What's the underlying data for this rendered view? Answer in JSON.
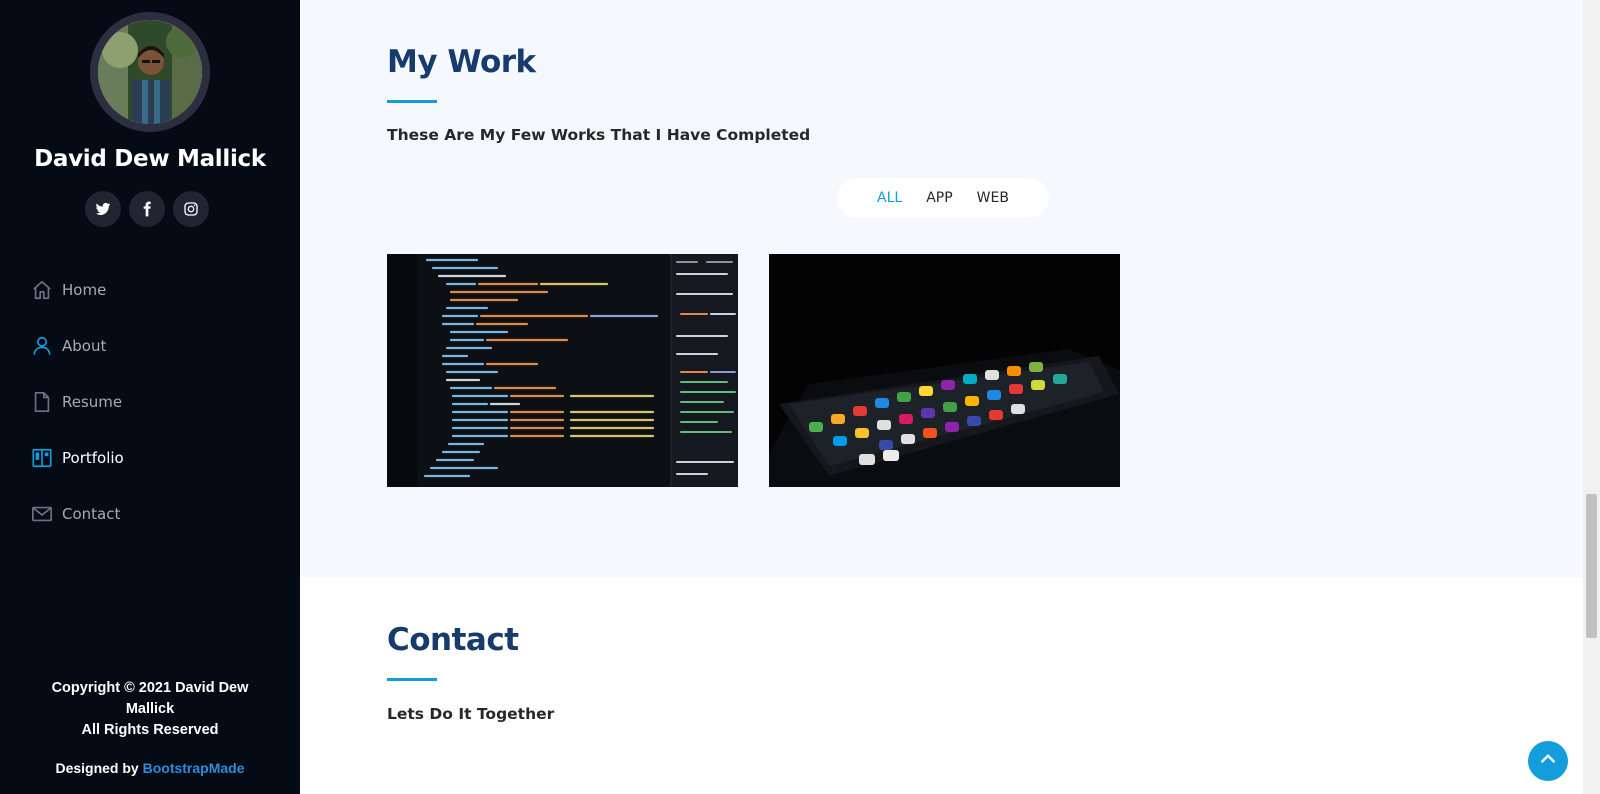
{
  "sidebar": {
    "name": "David Dew Mallick",
    "social": [
      "twitter-icon",
      "facebook-icon",
      "instagram-icon"
    ],
    "nav": [
      {
        "label": "Home",
        "icon": "home-icon"
      },
      {
        "label": "About",
        "icon": "person-icon"
      },
      {
        "label": "Resume",
        "icon": "file-icon"
      },
      {
        "label": "Portfolio",
        "icon": "book-icon",
        "active": true
      },
      {
        "label": "Contact",
        "icon": "envelope-icon"
      }
    ],
    "copyright_line1": "Copyright © 2021 David Dew",
    "copyright_line2": "Mallick",
    "copyright_line3": "All Rights Reserved",
    "designed_by_prefix": "Designed by ",
    "designed_by_link": "BootstrapMade"
  },
  "portfolio": {
    "title": "My Work",
    "subtitle": "These Are My Few Works That I Have Completed",
    "filters": [
      "ALL",
      "APP",
      "WEB"
    ],
    "active_filter": "ALL"
  },
  "contact": {
    "title": "Contact",
    "subtitle": "Lets Do It Together"
  },
  "colors": {
    "sidebar_bg": "#040b14",
    "accent": "#149ddd",
    "heading": "#173b6c",
    "section_bg": "#f5f8fd"
  }
}
